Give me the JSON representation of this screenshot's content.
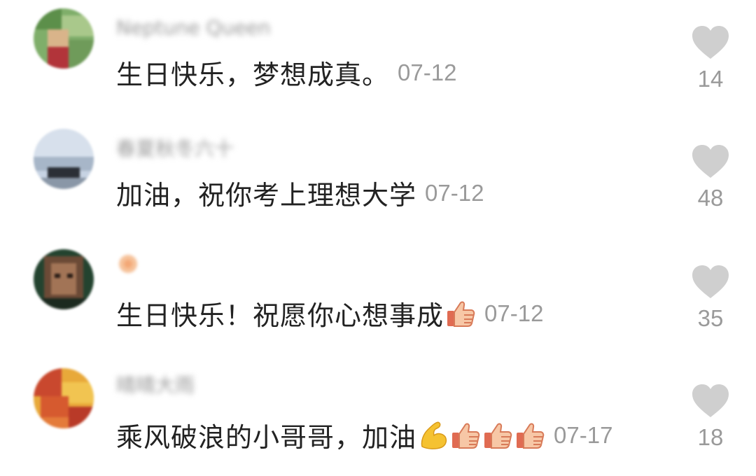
{
  "comments": [
    {
      "username": "Neptune Queen",
      "text": "生日快乐，梦想成真。",
      "emojis": [],
      "date": "07-12",
      "likes": "14"
    },
    {
      "username": "春夏秋冬六十",
      "text": "加油，祝你考上理想大学",
      "emojis": [],
      "date": "07-12",
      "likes": "48"
    },
    {
      "username": "",
      "text": "生日快乐！祝愿你心想事成",
      "emojis": [
        "thumbs-up"
      ],
      "date": "07-12",
      "likes": "35"
    },
    {
      "username": "晴晴大雨",
      "text": "乘风破浪的小哥哥，加油",
      "emojis": [
        "flexed-biceps",
        "thumbs-up",
        "thumbs-up",
        "thumbs-up"
      ],
      "date": "07-17",
      "likes": "18"
    }
  ],
  "colors": {
    "text": "#222222",
    "meta": "#9a9a9a",
    "heart": "#cfcfcf"
  },
  "icons": {
    "like": "heart-icon",
    "thumbs_up": "thumbs-up-emoji",
    "flexed_biceps": "flexed-biceps-emoji"
  }
}
